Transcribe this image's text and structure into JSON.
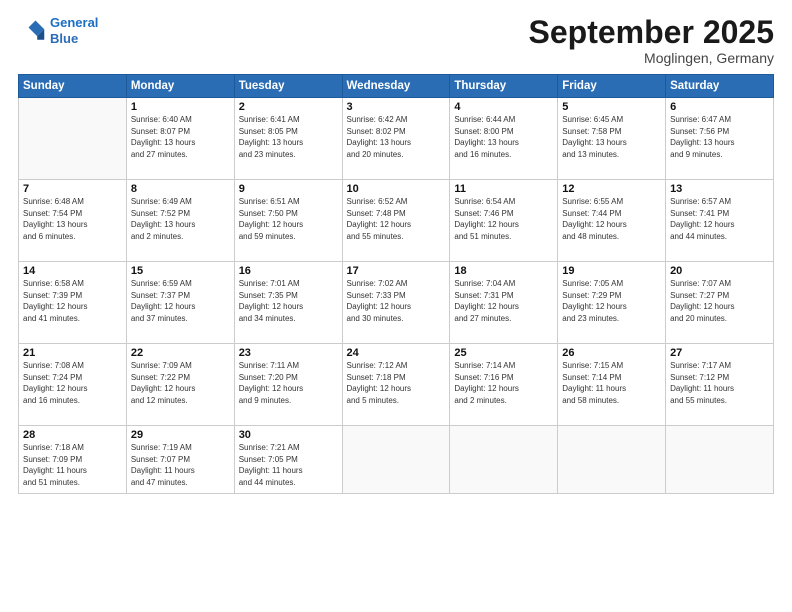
{
  "header": {
    "logo_line1": "General",
    "logo_line2": "Blue",
    "month": "September 2025",
    "location": "Moglingen, Germany"
  },
  "weekdays": [
    "Sunday",
    "Monday",
    "Tuesday",
    "Wednesday",
    "Thursday",
    "Friday",
    "Saturday"
  ],
  "weeks": [
    [
      {
        "day": "",
        "text": ""
      },
      {
        "day": "1",
        "text": "Sunrise: 6:40 AM\nSunset: 8:07 PM\nDaylight: 13 hours\nand 27 minutes."
      },
      {
        "day": "2",
        "text": "Sunrise: 6:41 AM\nSunset: 8:05 PM\nDaylight: 13 hours\nand 23 minutes."
      },
      {
        "day": "3",
        "text": "Sunrise: 6:42 AM\nSunset: 8:02 PM\nDaylight: 13 hours\nand 20 minutes."
      },
      {
        "day": "4",
        "text": "Sunrise: 6:44 AM\nSunset: 8:00 PM\nDaylight: 13 hours\nand 16 minutes."
      },
      {
        "day": "5",
        "text": "Sunrise: 6:45 AM\nSunset: 7:58 PM\nDaylight: 13 hours\nand 13 minutes."
      },
      {
        "day": "6",
        "text": "Sunrise: 6:47 AM\nSunset: 7:56 PM\nDaylight: 13 hours\nand 9 minutes."
      }
    ],
    [
      {
        "day": "7",
        "text": "Sunrise: 6:48 AM\nSunset: 7:54 PM\nDaylight: 13 hours\nand 6 minutes."
      },
      {
        "day": "8",
        "text": "Sunrise: 6:49 AM\nSunset: 7:52 PM\nDaylight: 13 hours\nand 2 minutes."
      },
      {
        "day": "9",
        "text": "Sunrise: 6:51 AM\nSunset: 7:50 PM\nDaylight: 12 hours\nand 59 minutes."
      },
      {
        "day": "10",
        "text": "Sunrise: 6:52 AM\nSunset: 7:48 PM\nDaylight: 12 hours\nand 55 minutes."
      },
      {
        "day": "11",
        "text": "Sunrise: 6:54 AM\nSunset: 7:46 PM\nDaylight: 12 hours\nand 51 minutes."
      },
      {
        "day": "12",
        "text": "Sunrise: 6:55 AM\nSunset: 7:44 PM\nDaylight: 12 hours\nand 48 minutes."
      },
      {
        "day": "13",
        "text": "Sunrise: 6:57 AM\nSunset: 7:41 PM\nDaylight: 12 hours\nand 44 minutes."
      }
    ],
    [
      {
        "day": "14",
        "text": "Sunrise: 6:58 AM\nSunset: 7:39 PM\nDaylight: 12 hours\nand 41 minutes."
      },
      {
        "day": "15",
        "text": "Sunrise: 6:59 AM\nSunset: 7:37 PM\nDaylight: 12 hours\nand 37 minutes."
      },
      {
        "day": "16",
        "text": "Sunrise: 7:01 AM\nSunset: 7:35 PM\nDaylight: 12 hours\nand 34 minutes."
      },
      {
        "day": "17",
        "text": "Sunrise: 7:02 AM\nSunset: 7:33 PM\nDaylight: 12 hours\nand 30 minutes."
      },
      {
        "day": "18",
        "text": "Sunrise: 7:04 AM\nSunset: 7:31 PM\nDaylight: 12 hours\nand 27 minutes."
      },
      {
        "day": "19",
        "text": "Sunrise: 7:05 AM\nSunset: 7:29 PM\nDaylight: 12 hours\nand 23 minutes."
      },
      {
        "day": "20",
        "text": "Sunrise: 7:07 AM\nSunset: 7:27 PM\nDaylight: 12 hours\nand 20 minutes."
      }
    ],
    [
      {
        "day": "21",
        "text": "Sunrise: 7:08 AM\nSunset: 7:24 PM\nDaylight: 12 hours\nand 16 minutes."
      },
      {
        "day": "22",
        "text": "Sunrise: 7:09 AM\nSunset: 7:22 PM\nDaylight: 12 hours\nand 12 minutes."
      },
      {
        "day": "23",
        "text": "Sunrise: 7:11 AM\nSunset: 7:20 PM\nDaylight: 12 hours\nand 9 minutes."
      },
      {
        "day": "24",
        "text": "Sunrise: 7:12 AM\nSunset: 7:18 PM\nDaylight: 12 hours\nand 5 minutes."
      },
      {
        "day": "25",
        "text": "Sunrise: 7:14 AM\nSunset: 7:16 PM\nDaylight: 12 hours\nand 2 minutes."
      },
      {
        "day": "26",
        "text": "Sunrise: 7:15 AM\nSunset: 7:14 PM\nDaylight: 11 hours\nand 58 minutes."
      },
      {
        "day": "27",
        "text": "Sunrise: 7:17 AM\nSunset: 7:12 PM\nDaylight: 11 hours\nand 55 minutes."
      }
    ],
    [
      {
        "day": "28",
        "text": "Sunrise: 7:18 AM\nSunset: 7:09 PM\nDaylight: 11 hours\nand 51 minutes."
      },
      {
        "day": "29",
        "text": "Sunrise: 7:19 AM\nSunset: 7:07 PM\nDaylight: 11 hours\nand 47 minutes."
      },
      {
        "day": "30",
        "text": "Sunrise: 7:21 AM\nSunset: 7:05 PM\nDaylight: 11 hours\nand 44 minutes."
      },
      {
        "day": "",
        "text": ""
      },
      {
        "day": "",
        "text": ""
      },
      {
        "day": "",
        "text": ""
      },
      {
        "day": "",
        "text": ""
      }
    ]
  ]
}
